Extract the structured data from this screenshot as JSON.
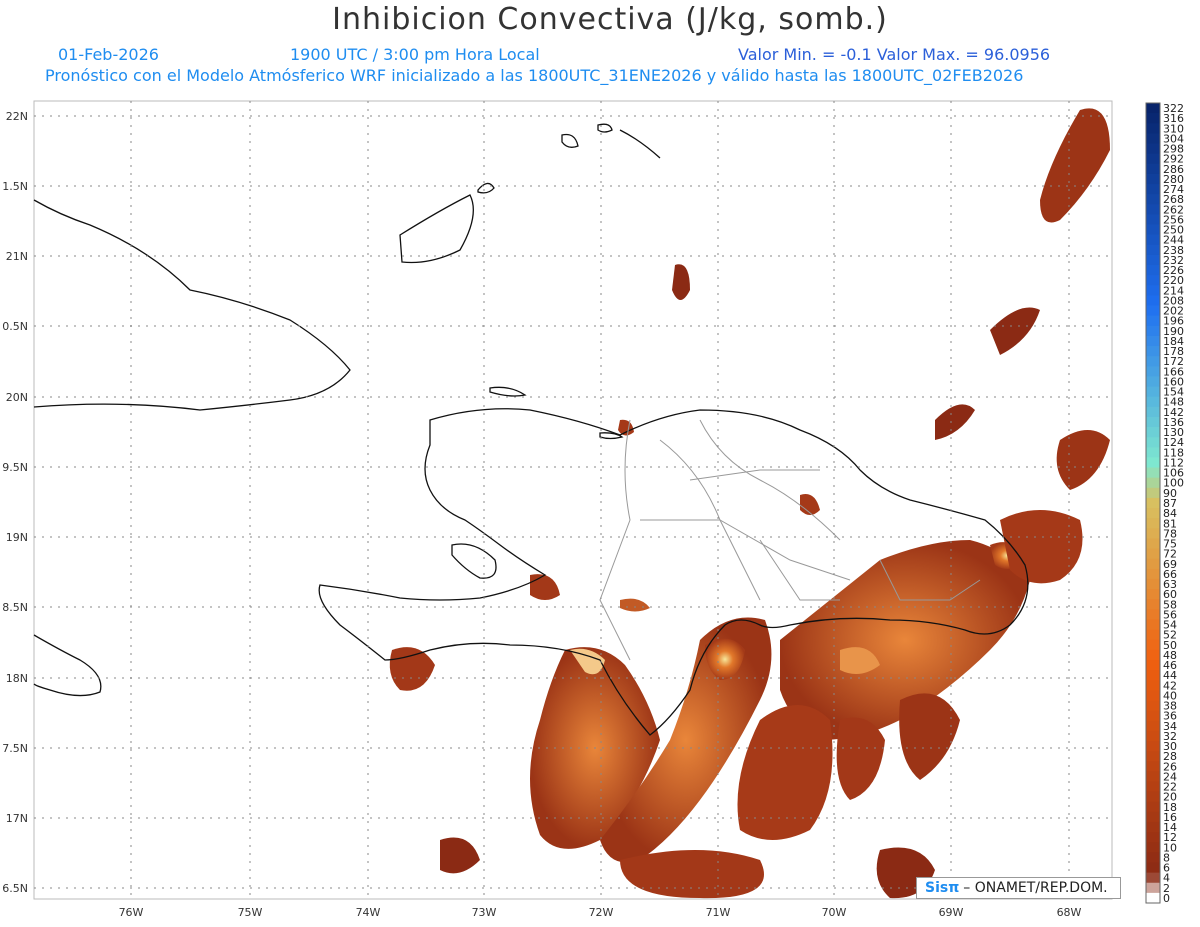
{
  "header": {
    "title": "Inhibicion Convectiva (J/kg, somb.)",
    "date": "01-Feb-2026",
    "time": "1900 UTC / 3:00 pm Hora Local",
    "minmax": "Valor Min. = -0.1  Valor Max. = 96.0956",
    "forecast": "Pronóstico con el Modelo Atmósferico WRF inicializado a las 1800UTC_31ENE2026 y válido hasta las  1800UTC_02FEB2026"
  },
  "map": {
    "lat_labels": [
      "22N",
      "1.5N",
      "21N",
      "0.5N",
      "20N",
      "9.5N",
      "19N",
      "8.5N",
      "18N",
      "7.5N",
      "17N",
      "6.5N"
    ],
    "lon_labels": [
      "76W",
      "75W",
      "74W",
      "73W",
      "72W",
      "71W",
      "70W",
      "69W",
      "68W"
    ]
  },
  "colorbar": {
    "labels": [
      "322",
      "316",
      "310",
      "304",
      "298",
      "292",
      "286",
      "280",
      "274",
      "268",
      "262",
      "256",
      "250",
      "244",
      "238",
      "232",
      "226",
      "220",
      "214",
      "208",
      "202",
      "196",
      "190",
      "184",
      "178",
      "172",
      "166",
      "160",
      "154",
      "148",
      "142",
      "136",
      "130",
      "124",
      "118",
      "112",
      "106",
      "100",
      "90",
      "87",
      "84",
      "81",
      "78",
      "75",
      "72",
      "69",
      "66",
      "63",
      "60",
      "58",
      "56",
      "54",
      "52",
      "50",
      "48",
      "46",
      "44",
      "42",
      "40",
      "38",
      "36",
      "34",
      "32",
      "30",
      "28",
      "26",
      "24",
      "22",
      "20",
      "18",
      "16",
      "14",
      "12",
      "10",
      "8",
      "6",
      "4",
      "2",
      "0"
    ]
  },
  "credit": {
    "logo": "Sisπ",
    "text": "– ONAMET/REP.DOM."
  },
  "colors": {
    "blue_dark": "#08246b",
    "blue_mid": "#1f6ff0",
    "cyan": "#7fe8d0",
    "tan": "#d8c060",
    "orange": "#f06010",
    "brown": "#8b2a14"
  }
}
